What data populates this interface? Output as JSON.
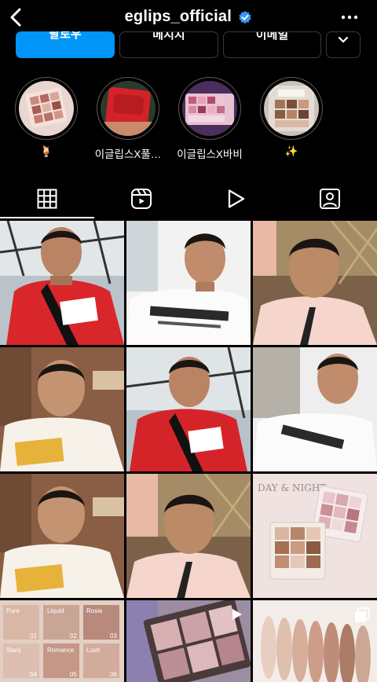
{
  "header": {
    "username": "eglips_official"
  },
  "buttons": {
    "follow": "팔로우",
    "message": "메시지",
    "email": "이메일"
  },
  "highlights": [
    {
      "label": "🍹"
    },
    {
      "label": "이글립스X풀…"
    },
    {
      "label": "이글립스X바비"
    },
    {
      "label": "✨"
    }
  ],
  "posts": {
    "palette_caption": "DAY & NIGHT",
    "shade_names": [
      "Pure",
      "Liquid",
      "Rosie",
      "Stars",
      "Romance",
      "Lush"
    ],
    "shade_numbers": [
      "01",
      "02",
      "03",
      "04",
      "05",
      "06"
    ]
  },
  "colors": {
    "accent": "#0095f6",
    "background": "#000000",
    "border": "#3a3a3a"
  }
}
